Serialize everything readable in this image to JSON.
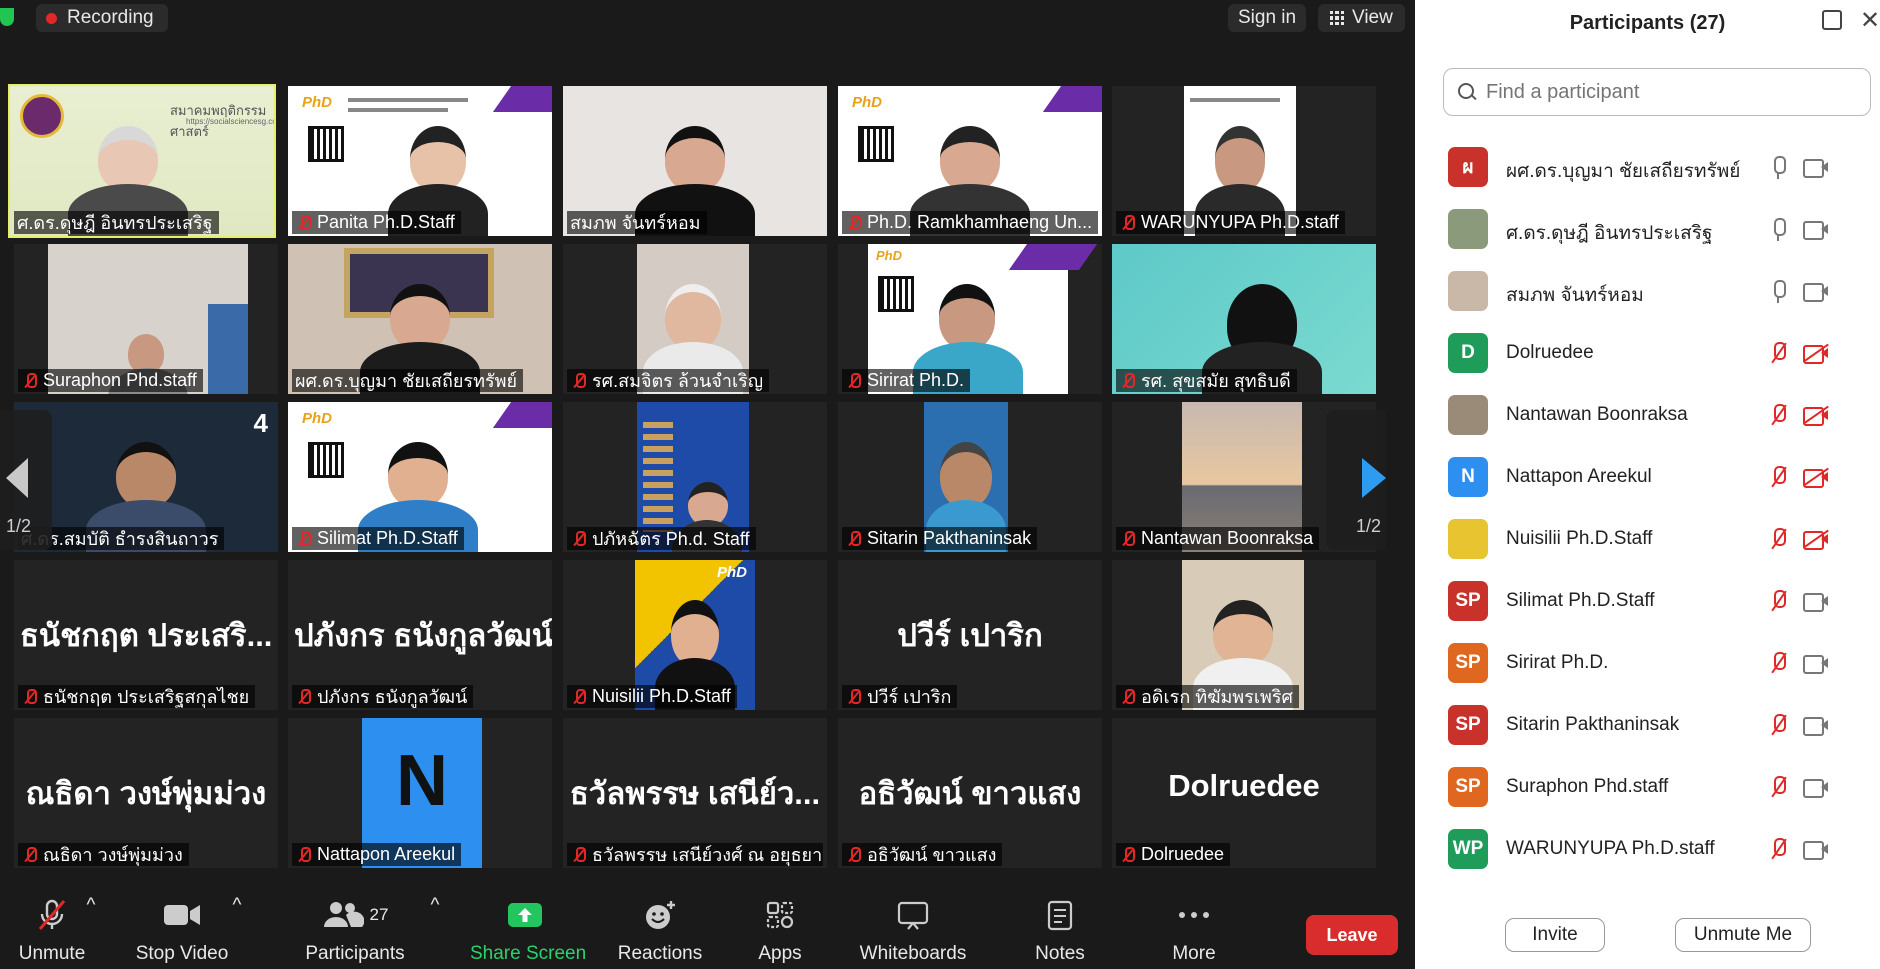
{
  "topbar": {
    "recording": "Recording",
    "sign_in": "Sign in",
    "view": "View"
  },
  "pager": {
    "left": "1/2",
    "right": "1/2"
  },
  "tiles": [
    {
      "name": "ศ.ดร.ดุษฎี อินทรประเสริฐ",
      "overlay": "สมาคมพฤติกรรมศาสตร์",
      "url": "https://socialsciencesg.com/"
    },
    {
      "name": "Panita Ph.D.Staff",
      "brand": "PhD"
    },
    {
      "name": "สมภพ จันทร์หอม"
    },
    {
      "name": "Ph.D. Ramkhamhaeng Un...",
      "brand": "PhD"
    },
    {
      "name": "WARUNYUPA Ph.D.staff"
    },
    {
      "name": "Suraphon Phd.staff"
    },
    {
      "name": "ผศ.ดร.บุญมา ชัยเสถียรทรัพย์"
    },
    {
      "name": "รศ.สมจิตร ล้วนจำเริญ"
    },
    {
      "name": "Sirirat Ph.D.",
      "brand": "PhD"
    },
    {
      "name": "รศ. สุขสมัย สุทธิบดี"
    },
    {
      "name": "ศ.ดร.สมบัติ ธำรงสินถาวร"
    },
    {
      "name": "Silimat Ph.D.Staff",
      "brand": "PhD"
    },
    {
      "name": "ปภัหฉัตร Ph.d. Staff"
    },
    {
      "name": "Sitarin Pakthaninsak"
    },
    {
      "name": "Nantawan Boonraksa"
    },
    {
      "name": "ธนัชกฤต ประเสริฐสกุลไชย",
      "big": "ธนัชกฤต ประเสริ..."
    },
    {
      "name": "ปภังกร ธนังกูลวัฒน์",
      "big": "ปภังกร ธนังกูลวัฒน์"
    },
    {
      "name": "Nuisilii Ph.D.Staff",
      "brand": "PhD"
    },
    {
      "name": "ปวีร์ เปาริก",
      "big": "ปวีร์ เปาริก"
    },
    {
      "name": "อดิเรก ทิฆัมพรเพริศ"
    },
    {
      "name": "ณธิดา วงษ์พุ่มม่วง",
      "big": "ณธิดา วงษ์พุ่มม่วง"
    },
    {
      "name": "Nattapon Areekul",
      "letter": "N"
    },
    {
      "name": "ธวัลพรรษ เสนีย์วงศ์ ณ อยุธยา",
      "big": "ธวัลพรรษ เสนีย์ว..."
    },
    {
      "name": "อธิวัฒน์ ขาวแสง",
      "big": "อธิวัฒน์ ขาวแสง"
    },
    {
      "name": "Dolruedee",
      "big": "Dolruedee"
    }
  ],
  "toolbar": {
    "unmute": "Unmute",
    "stop_video": "Stop Video",
    "participants": "Participants",
    "participants_count": "27",
    "share_screen": "Share Screen",
    "reactions": "Reactions",
    "apps": "Apps",
    "whiteboards": "Whiteboards",
    "notes": "Notes",
    "more": "More",
    "leave": "Leave"
  },
  "panel": {
    "title": "Participants (27)",
    "search_placeholder": "Find a participant",
    "invite": "Invite",
    "unmute_me": "Unmute Me",
    "participants": [
      {
        "name": "ผศ.ดร.บุญมา ชัยเสถียรทรัพย์",
        "initials": "ผ",
        "color": "#c8322b",
        "mic": "on",
        "cam": "on"
      },
      {
        "name": "ศ.ดร.ดุษฎี อินทรประเสริฐ",
        "initials": "",
        "color": "#8a9a7a",
        "mic": "on",
        "cam": "on"
      },
      {
        "name": "สมภพ จันทร์หอม",
        "initials": "",
        "color": "#c9b8a8",
        "mic": "on",
        "cam": "on"
      },
      {
        "name": "Dolruedee",
        "initials": "D",
        "color": "#1f9c5a",
        "mic": "off",
        "cam": "off"
      },
      {
        "name": "Nantawan Boonraksa",
        "initials": "",
        "color": "#9a8a78",
        "mic": "off",
        "cam": "off"
      },
      {
        "name": "Nattapon Areekul",
        "initials": "N",
        "color": "#2d8ff0",
        "mic": "off",
        "cam": "off"
      },
      {
        "name": "Nuisilii Ph.D.Staff",
        "initials": "",
        "color": "#e8c430",
        "mic": "off",
        "cam": "off"
      },
      {
        "name": "Silimat Ph.D.Staff",
        "initials": "SP",
        "color": "#c8322b",
        "mic": "off",
        "cam": "on"
      },
      {
        "name": "Sirirat Ph.D.",
        "initials": "SP",
        "color": "#e0671f",
        "mic": "off",
        "cam": "on"
      },
      {
        "name": "Sitarin Pakthaninsak",
        "initials": "SP",
        "color": "#c8322b",
        "mic": "off",
        "cam": "on"
      },
      {
        "name": "Suraphon Phd.staff",
        "initials": "SP",
        "color": "#e0671f",
        "mic": "off",
        "cam": "on"
      },
      {
        "name": "WARUNYUPA Ph.D.staff",
        "initials": "WP",
        "color": "#1f9c5a",
        "mic": "off",
        "cam": "on"
      }
    ]
  }
}
